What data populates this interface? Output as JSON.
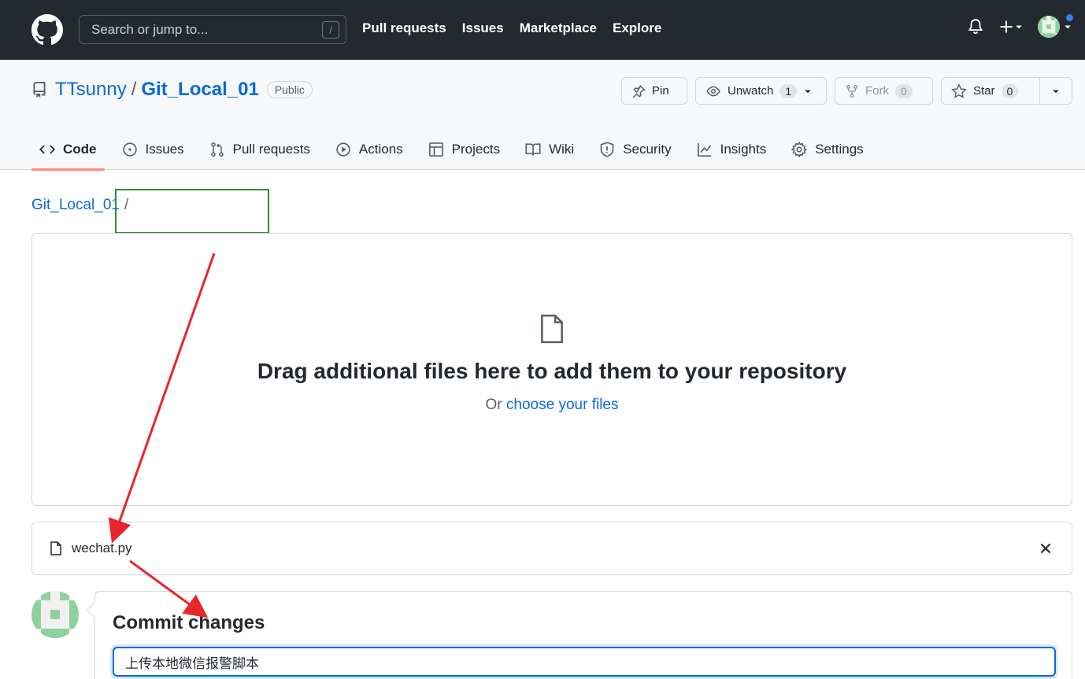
{
  "header": {
    "search_placeholder": "Search or jump to...",
    "search_shortcut": "/",
    "nav": [
      "Pull requests",
      "Issues",
      "Marketplace",
      "Explore"
    ]
  },
  "repo": {
    "owner": "TTsunny",
    "separator": "/",
    "name": "Git_Local_01",
    "visibility": "Public",
    "actions": {
      "pin": "Pin",
      "unwatch": "Unwatch",
      "unwatch_count": "1",
      "fork": "Fork",
      "fork_count": "0",
      "star": "Star",
      "star_count": "0"
    },
    "tabs": [
      "Code",
      "Issues",
      "Pull requests",
      "Actions",
      "Projects",
      "Wiki",
      "Security",
      "Insights",
      "Settings"
    ]
  },
  "breadcrumb": {
    "repo": "Git_Local_01",
    "slash": "/"
  },
  "dropzone": {
    "title": "Drag additional files here to add them to your repository",
    "prefix": "Or",
    "link": "choose your files"
  },
  "file": {
    "name": "wechat.py"
  },
  "commit": {
    "title": "Commit changes",
    "message_value": "上传本地微信报警脚本"
  },
  "colors": {
    "header_bg": "#24292f",
    "link": "#0969da",
    "active_tab": "#fd8c73",
    "annotation_box": "#2e8b2e",
    "annotation_arrow": "#e8262b"
  }
}
